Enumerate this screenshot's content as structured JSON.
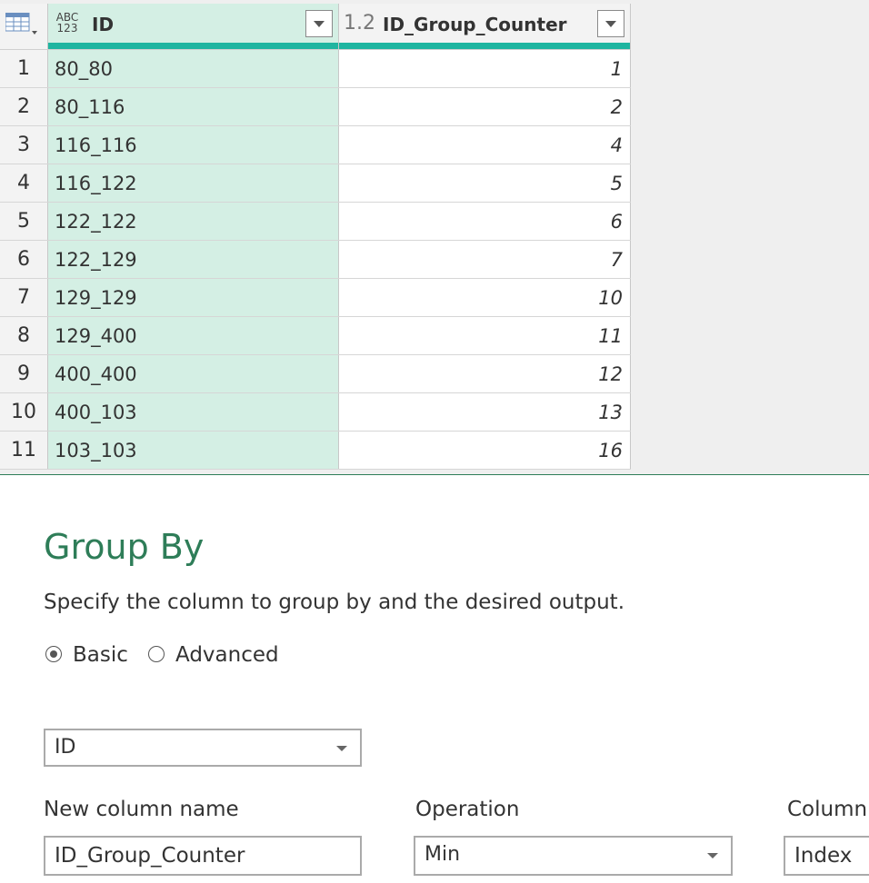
{
  "grid": {
    "columns": [
      {
        "type_icon": "ABC 123",
        "name": "ID"
      },
      {
        "type_icon": "1.2",
        "name": "ID_Group_Counter"
      }
    ],
    "rows": [
      {
        "n": "1",
        "id": "80_80",
        "counter": "1"
      },
      {
        "n": "2",
        "id": "80_116",
        "counter": "2"
      },
      {
        "n": "3",
        "id": "116_116",
        "counter": "4"
      },
      {
        "n": "4",
        "id": "116_122",
        "counter": "5"
      },
      {
        "n": "5",
        "id": "122_122",
        "counter": "6"
      },
      {
        "n": "6",
        "id": "122_129",
        "counter": "7"
      },
      {
        "n": "7",
        "id": "129_129",
        "counter": "10"
      },
      {
        "n": "8",
        "id": "129_400",
        "counter": "11"
      },
      {
        "n": "9",
        "id": "400_400",
        "counter": "12"
      },
      {
        "n": "10",
        "id": "400_103",
        "counter": "13"
      },
      {
        "n": "11",
        "id": "103_103",
        "counter": "16"
      }
    ]
  },
  "dialog": {
    "title": "Group By",
    "description": "Specify the column to group by and the desired output.",
    "mode_basic": "Basic",
    "mode_advanced": "Advanced",
    "selected_mode": "Basic",
    "group_by_column": "ID",
    "new_column_label": "New column name",
    "new_column_value": "ID_Group_Counter",
    "operation_label": "Operation",
    "operation_value": "Min",
    "column_label": "Column",
    "column_value": "Index"
  },
  "colors": {
    "accent": "#2e7d58",
    "selected_column": "#d4efe4",
    "column_bar": "#1fb5a0"
  }
}
